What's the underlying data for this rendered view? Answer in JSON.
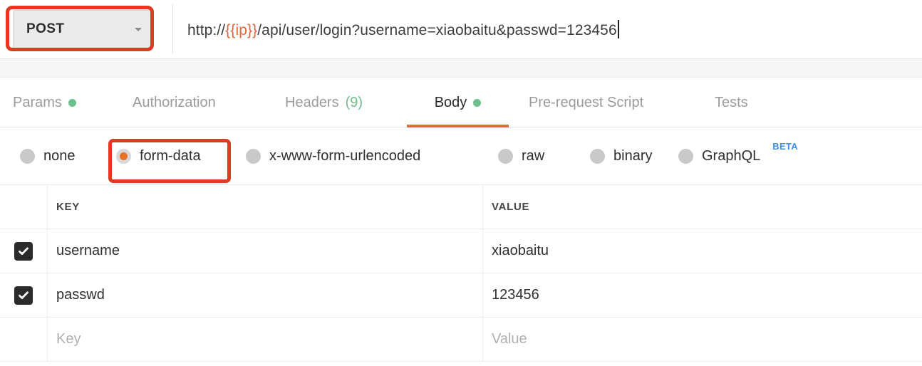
{
  "request": {
    "method": "POST",
    "method_caret_icon": "chevron-down-icon",
    "url_prefix": "http://",
    "url_variable": "{{ip}}",
    "url_suffix": "/api/user/login?username=xiaobaitu&passwd=123456"
  },
  "tabs": [
    {
      "label": "Params",
      "indicator": "dot",
      "active": false
    },
    {
      "label": "Authorization",
      "indicator": "none",
      "active": false
    },
    {
      "label": "Headers",
      "count": "(9)",
      "indicator": "count",
      "active": false
    },
    {
      "label": "Body",
      "indicator": "dot",
      "active": true
    },
    {
      "label": "Pre-request Script",
      "indicator": "none",
      "active": false
    },
    {
      "label": "Tests",
      "indicator": "none",
      "active": false
    }
  ],
  "body_types": [
    {
      "label": "none",
      "selected": false
    },
    {
      "label": "form-data",
      "selected": true
    },
    {
      "label": "x-www-form-urlencoded",
      "selected": false
    },
    {
      "label": "raw",
      "selected": false
    },
    {
      "label": "binary",
      "selected": false
    },
    {
      "label": "GraphQL",
      "selected": false,
      "badge": "BETA"
    }
  ],
  "table": {
    "headers": {
      "key": "KEY",
      "value": "VALUE"
    },
    "rows": [
      {
        "checked": true,
        "key": "username",
        "value": "xiaobaitu"
      },
      {
        "checked": true,
        "key": "passwd",
        "value": "123456"
      }
    ],
    "placeholder_row": {
      "key": "Key",
      "value": "Value"
    }
  },
  "colors": {
    "highlight_box": "#e03a23",
    "active_tab_underline": "#e06c3b",
    "indicator_green": "#6dbf8b",
    "selected_radio": "#e8732a",
    "beta_badge": "#3d8fe8",
    "url_variable": "#e0663c"
  }
}
